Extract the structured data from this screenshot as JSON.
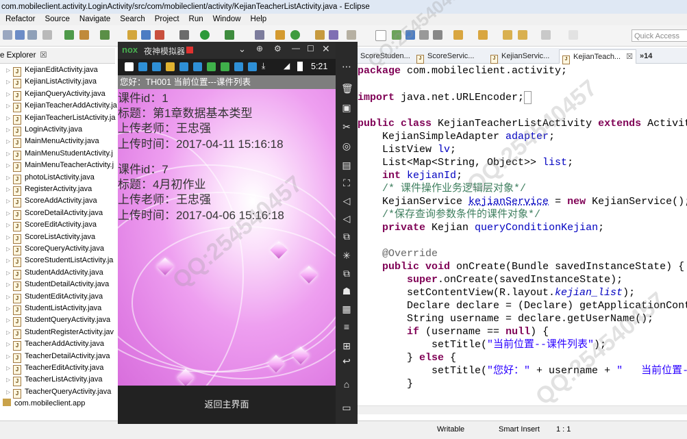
{
  "window": {
    "title": "com.mobileclient.activity.LoginActivity/src/com/mobileclient/activity/KejianTeacherListActivity.java - Eclipse"
  },
  "menu": [
    "Refactor",
    "Source",
    "Navigate",
    "Search",
    "Project",
    "Run",
    "Window",
    "Help"
  ],
  "quick_access": {
    "placeholder": "Quick Access"
  },
  "package_explorer": {
    "title": "e Explorer",
    "close": "☒",
    "files": [
      "KejianEditActivity.java",
      "KejianListActivity.java",
      "KejianQueryActivity.java",
      "KejianTeacherAddActivity.ja",
      "KejianTeacherListActivity.ja",
      "LoginActivity.java",
      "MainMenuActivity.java",
      "MainMenuStudentActivity.j",
      "MainMenuTeacherActivity.j",
      "photoListActivity.java",
      "RegisterActivity.java",
      "ScoreAddActivity.java",
      "ScoreDetailActivity.java",
      "ScoreEditActivity.java",
      "ScoreListActivity.java",
      "ScoreQueryActivity.java",
      "ScoreStudentListActivity.ja",
      "StudentAddActivity.java",
      "StudentDetailActivity.java",
      "StudentEditActivity.java",
      "StudentListActivity.java",
      "StudentQueryActivity.java",
      "StudentRegisterActivity.jav",
      "TeacherAddActivity.java",
      "TeacherDetailActivity.java",
      "TeacherEditActivity.java",
      "TeacherListActivity.java",
      "TeacherQueryActivity.java"
    ],
    "package": "com.mobileclient.app"
  },
  "editor_tabs": [
    {
      "label": "ScoreStuden..."
    },
    {
      "label": "ScoreServic..."
    },
    {
      "label": "KejianServic..."
    },
    {
      "label": "KejianTeach..."
    }
  ],
  "editor_tab_overflow": "»14",
  "emulator": {
    "title": "夜神模拟器",
    "brand": "nox",
    "time": "5:21",
    "app_title": "您好：TH001  当前位置---课件列表",
    "items": [
      {
        "id": "课件id：1",
        "title": "标题：第1章数据基本类型",
        "teacher": "上传老师：王忠强",
        "time": "上传时间：2017-04-11 15:16:18"
      },
      {
        "id": "课件id：7",
        "title": "标题：4月初作业",
        "teacher": "上传老师：王忠强",
        "time": "上传时间：2017-04-06 15:16:18"
      }
    ],
    "back_button": "返回主界面"
  },
  "statusbar": {
    "writable": "Writable",
    "insert_mode": "Smart Insert",
    "position": "1 : 1"
  },
  "watermark": "QQ:254540457"
}
